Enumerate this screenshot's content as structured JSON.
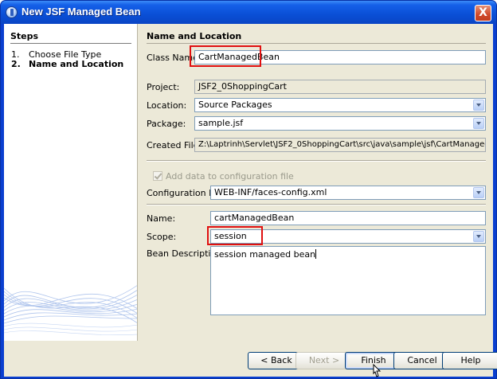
{
  "window": {
    "title": "New JSF Managed Bean",
    "close_label": "X"
  },
  "steps": {
    "title": "Steps",
    "items": [
      {
        "num": "1.",
        "label": "Choose File Type"
      },
      {
        "num": "2.",
        "label": "Name and Location"
      }
    ]
  },
  "panel": {
    "title": "Name and Location",
    "class_name": {
      "label": "Class Name:",
      "value": "CartManagedBean"
    },
    "project": {
      "label": "Project:",
      "value": "JSF2_0ShoppingCart"
    },
    "location": {
      "label": "Location:",
      "value": "Source Packages"
    },
    "package": {
      "label": "Package:",
      "value": "sample.jsf"
    },
    "created_file": {
      "label": "Created File:",
      "value": "Z:\\Laptrinh\\Servlet\\JSF2_0ShoppingCart\\src\\java\\sample\\jsf\\CartManagedBean.java"
    },
    "add_config": {
      "label": "Add data to configuration file"
    },
    "config_file": {
      "label": "Configuration File:",
      "value": "WEB-INF/faces-config.xml"
    },
    "name": {
      "label": "Name:",
      "value": "cartManagedBean"
    },
    "scope": {
      "label": "Scope:",
      "value": "session"
    },
    "bean_description": {
      "label": "Bean Description:",
      "value": "session managed bean"
    }
  },
  "buttons": {
    "back": "< Back",
    "next": "Next >",
    "finish": "Finish",
    "cancel": "Cancel",
    "help": "Help"
  }
}
